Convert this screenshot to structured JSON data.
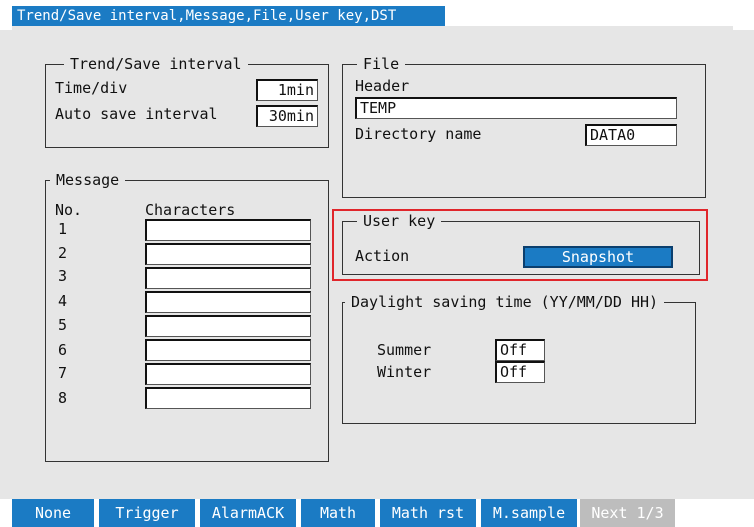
{
  "title": "Trend/Save interval,Message,File,User key,DST",
  "trend_save": {
    "legend": "Trend/Save interval",
    "time_div_label": "Time/div",
    "time_div_value": "1min",
    "auto_save_label": "Auto save interval",
    "auto_save_value": "30min"
  },
  "message": {
    "legend": "Message",
    "col_no": "No.",
    "col_chars": "Characters",
    "rows": [
      {
        "no": "1",
        "text": ""
      },
      {
        "no": "2",
        "text": ""
      },
      {
        "no": "3",
        "text": ""
      },
      {
        "no": "4",
        "text": ""
      },
      {
        "no": "5",
        "text": ""
      },
      {
        "no": "6",
        "text": ""
      },
      {
        "no": "7",
        "text": ""
      },
      {
        "no": "8",
        "text": ""
      }
    ]
  },
  "file": {
    "legend": "File",
    "header_label": "Header",
    "header_value": "TEMP",
    "dir_label": "Directory name",
    "dir_value": "DATA0"
  },
  "user_key": {
    "legend": "User key",
    "action_label": "Action",
    "action_value": "Snapshot"
  },
  "dst": {
    "legend": "Daylight saving time (YY/MM/DD HH)",
    "summer_label": "Summer",
    "summer_value": "Off",
    "winter_label": "Winter",
    "winter_value": "Off"
  },
  "softkeys": [
    "None",
    "Trigger",
    "AlarmACK",
    "Math",
    "Math rst",
    "M.sample",
    "Next 1/3"
  ],
  "colors": {
    "accent": "#1b7bc4",
    "highlight": "#e0262b",
    "background": "#e6e6e6"
  }
}
